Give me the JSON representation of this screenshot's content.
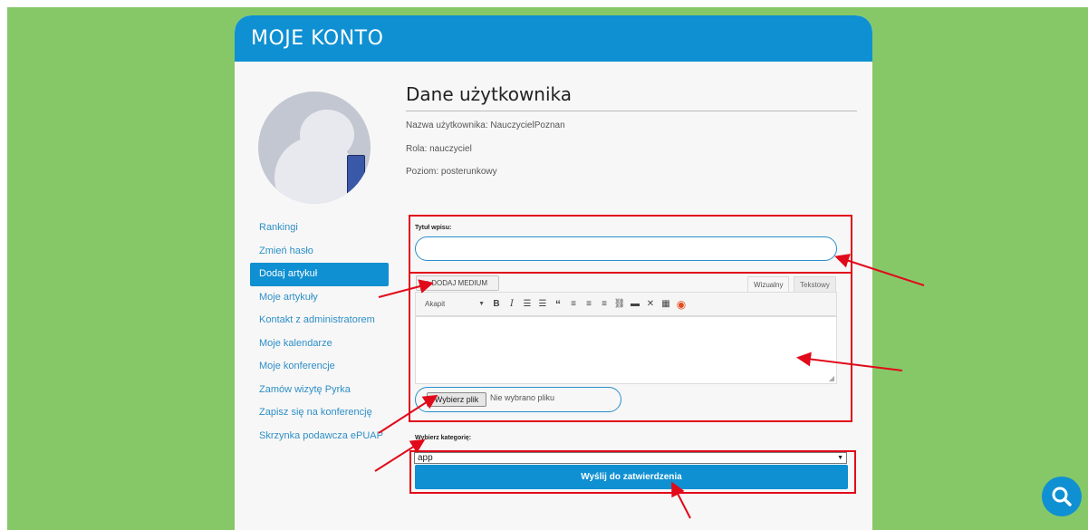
{
  "header": {
    "title": "MOJE KONTO"
  },
  "profile": {
    "section_title": "Dane użytkownika",
    "username_line": "Nazwa użytkownika: NauczycielPoznan",
    "role_line": "Rola: nauczyciel",
    "level_line": "Poziom: posterunkowy"
  },
  "sidebar": {
    "items": [
      {
        "label": "Rankingi",
        "active": false
      },
      {
        "label": "Zmień hasło",
        "active": false
      },
      {
        "label": "Dodaj artykuł",
        "active": true
      },
      {
        "label": "Moje artykuły",
        "active": false
      },
      {
        "label": "Kontakt z administratorem",
        "active": false
      },
      {
        "label": "Moje kalendarze",
        "active": false
      },
      {
        "label": "Moje konferencje",
        "active": false
      },
      {
        "label": "Zamów wizytę Pyrka",
        "active": false
      },
      {
        "label": "Zapisz się na konferencję",
        "active": false
      },
      {
        "label": "Skrzynka podawcza ePUAP",
        "active": false
      }
    ]
  },
  "form": {
    "title_label": "Tytuł wpisu:",
    "title_value": "",
    "add_media_label": "DODAJ MEDIUM",
    "tab_visual": "Wizualny",
    "tab_text": "Tekstowy",
    "format_select": "Akapit",
    "file_button": "Wybierz plik",
    "file_status": "Nie wybrano pliku",
    "category_label": "Wybierz kategorię:",
    "category_value": "app",
    "submit_label": "Wyślij do zatwierdzenia"
  },
  "colors": {
    "background": "#86c868",
    "brand_blue": "#0f90d2",
    "annotation_red": "#e10a1a"
  },
  "icons": {
    "toolbar": [
      "bold-icon",
      "italic-icon",
      "bullet-list-icon",
      "numbered-list-icon",
      "blockquote-icon",
      "align-left-icon",
      "align-center-icon",
      "align-right-icon",
      "link-icon",
      "read-more-icon",
      "fullscreen-icon",
      "toolbar-toggle-icon",
      "record-icon"
    ],
    "fab": "search-icon"
  }
}
